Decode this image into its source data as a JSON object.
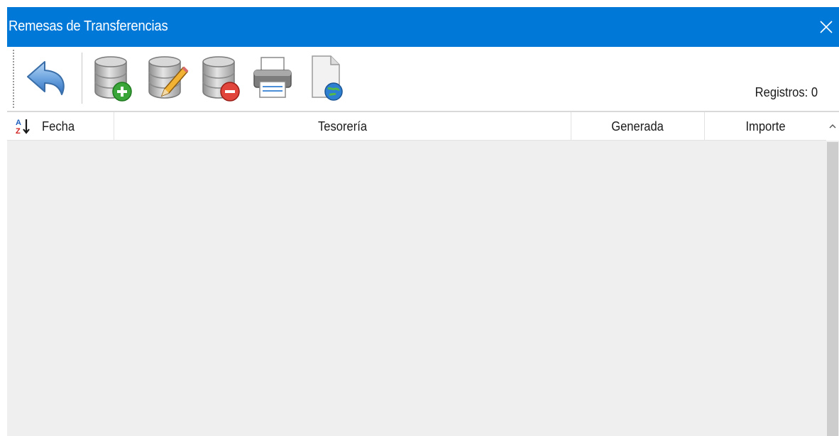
{
  "window": {
    "title": "Remesas de Transferencias",
    "accent_color": "#0078d7"
  },
  "toolbar": {
    "buttons": [
      {
        "name": "back",
        "icon": "undo-arrow-icon"
      },
      {
        "name": "new",
        "icon": "database-add-icon"
      },
      {
        "name": "edit",
        "icon": "database-edit-icon"
      },
      {
        "name": "delete",
        "icon": "database-delete-icon"
      },
      {
        "name": "print",
        "icon": "printer-icon"
      },
      {
        "name": "export",
        "icon": "document-globe-icon"
      }
    ],
    "records_label": "Registros:",
    "records_count": "0"
  },
  "grid": {
    "columns": [
      "Fecha",
      "Tesorería",
      "Generada",
      "Importe"
    ],
    "sort_icon": "sort-az-icon",
    "rows": []
  }
}
